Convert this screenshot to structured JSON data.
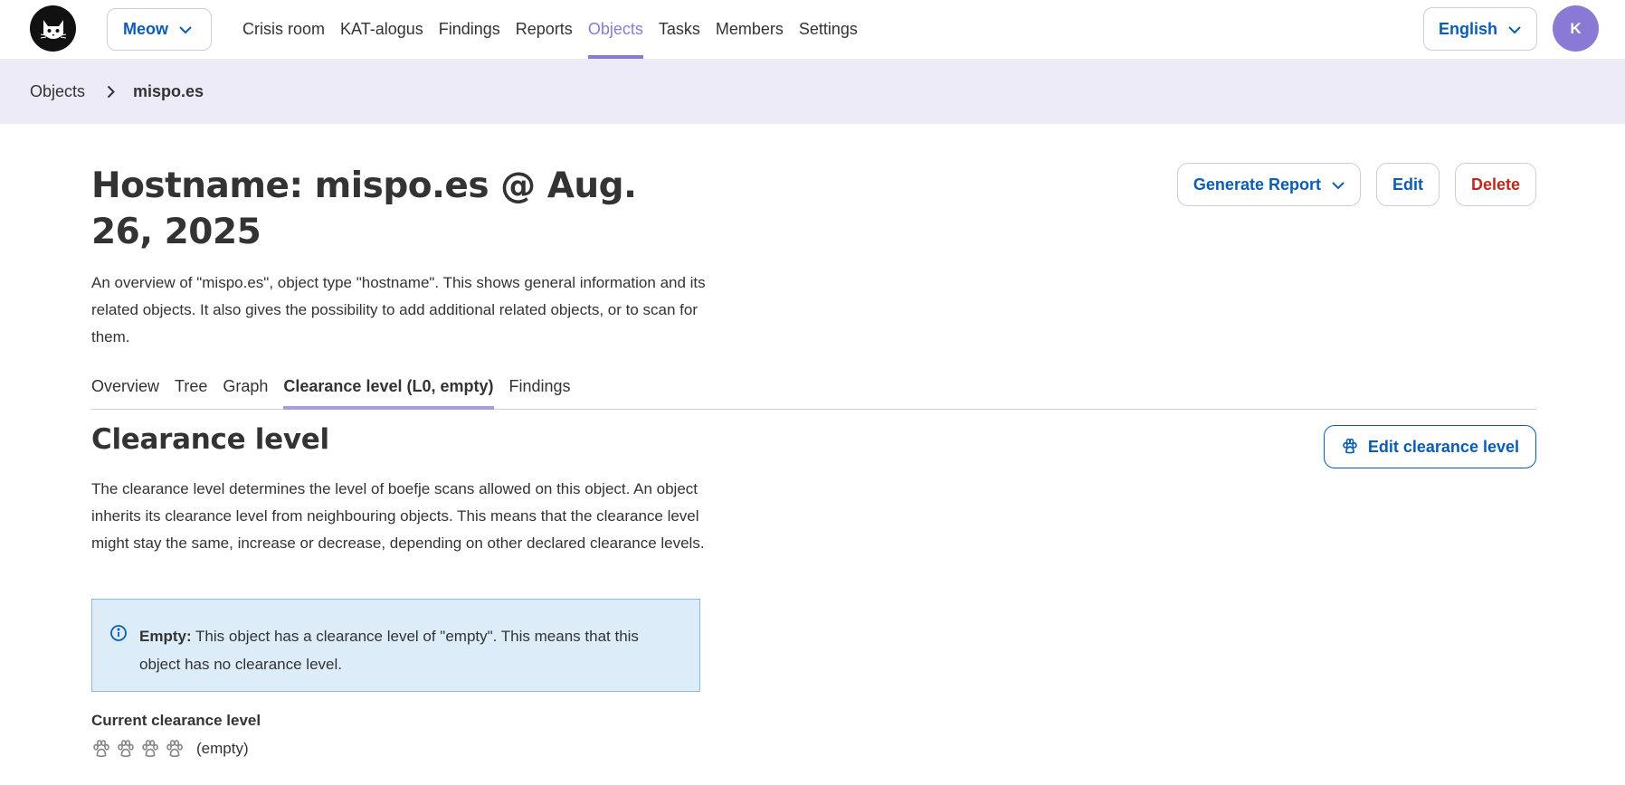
{
  "header": {
    "org_select": "Meow",
    "nav": [
      "Crisis room",
      "KAT-alogus",
      "Findings",
      "Reports",
      "Objects",
      "Tasks",
      "Members",
      "Settings"
    ],
    "active_nav": "Objects",
    "language": "English",
    "avatar_initial": "K"
  },
  "breadcrumb": {
    "items": [
      "Objects"
    ],
    "current": "mispo.es"
  },
  "page": {
    "title": "Hostname: mispo.es @ Aug. 26, 2025",
    "description": "An overview of \"mispo.es\", object type \"hostname\". This shows general information and its related objects. It also gives the possibility to add additional related objects, or to scan for them.",
    "actions": {
      "generate_report": "Generate Report",
      "edit": "Edit",
      "delete": "Delete"
    }
  },
  "tabs": [
    "Overview",
    "Tree",
    "Graph",
    "Clearance level (L0, empty)",
    "Findings"
  ],
  "active_tab": "Clearance level (L0, empty)",
  "clearance": {
    "title": "Clearance level",
    "edit_button": "Edit clearance level",
    "description": "The clearance level determines the level of boefje scans allowed on this object. An object inherits its clearance level from neighbouring objects. This means that the clearance level might stay the same, increase or decrease, depending on other declared clearance levels.",
    "notice_title": "Empty:",
    "notice_text": " This object has a clearance level of \"empty\". This means that this object has no clearance level.",
    "current_label": "Current clearance level",
    "current_value": "(empty)",
    "level": 0,
    "max_level": 4
  },
  "colors": {
    "accent": "#8a7ad6",
    "link": "#0a5db3",
    "danger": "#c0281d",
    "breadcrumb_bg": "#edebf7",
    "notice_bg": "#dcecf8"
  },
  "icons": [
    "cat-logo-icon",
    "chevron-down-icon",
    "chevron-right-icon",
    "paw-icon",
    "info-icon"
  ]
}
